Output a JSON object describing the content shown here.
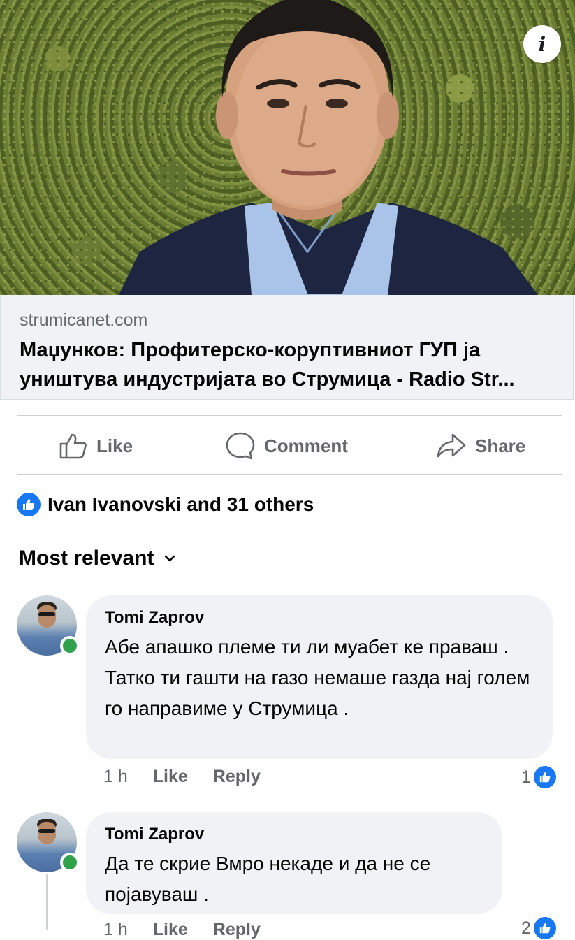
{
  "link_preview": {
    "domain": "strumicanet.com",
    "title": "Маџунков: Профитерско-коруптивниот ГУП ја уништува индустријата во Струмица - Radio Str..."
  },
  "actions": {
    "like": "Like",
    "comment": "Comment",
    "share": "Share"
  },
  "reactions": {
    "summary": "Ivan Ivanovski and 31 others"
  },
  "comments_header": {
    "sort_label": "Most relevant"
  },
  "comments": [
    {
      "author": "Tomi Zaprov",
      "text": "Абе апашко племе ти ли муабет ке праваш .\nТатко ти гашти на газо немаше газда нај голем го направиме у Струмица .",
      "time": "1 h",
      "like_label": "Like",
      "reply_label": "Reply",
      "like_count": "1"
    },
    {
      "author": "Tomi Zaprov",
      "text": "Да те скрие Вмро некаде и да не се појавуваш .",
      "time": "1 h",
      "like_label": "Like",
      "reply_label": "Reply",
      "like_count": "2"
    }
  ],
  "colors": {
    "facebook_blue": "#1877f2",
    "online_green": "#31a24c",
    "secondary_text": "#65676b",
    "bubble_bg": "#f0f2f5"
  }
}
